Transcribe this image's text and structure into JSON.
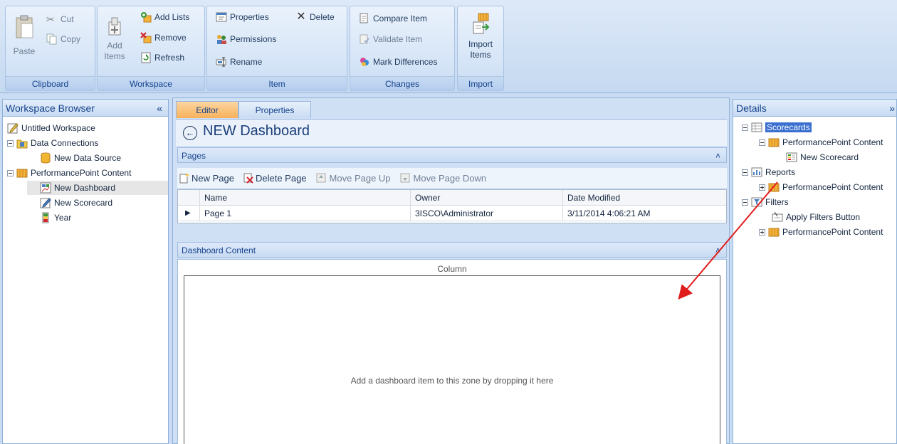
{
  "ribbon": {
    "clipboard": {
      "label": "Clipboard",
      "paste": "Paste",
      "cut": "Cut",
      "copy": "Copy"
    },
    "workspace": {
      "label": "Workspace",
      "add_items": [
        "Add",
        "Items"
      ],
      "add_lists": "Add Lists",
      "remove": "Remove",
      "refresh": "Refresh"
    },
    "item": {
      "label": "Item",
      "properties": "Properties",
      "delete": "Delete",
      "permissions": "Permissions",
      "rename": "Rename"
    },
    "changes": {
      "label": "Changes",
      "compare": "Compare Item",
      "validate": "Validate Item",
      "mark": "Mark Differences"
    },
    "import": {
      "label": "Import",
      "import_items": [
        "Import",
        "Items"
      ]
    }
  },
  "workspace_browser": {
    "title": "Workspace Browser",
    "collapse": "«",
    "items": [
      {
        "label": "Untitled Workspace",
        "icon": "workspace-icon"
      },
      {
        "label": "Data Connections",
        "icon": "data-connections-folder-icon"
      },
      {
        "label": "New Data Source",
        "icon": "data-source-icon"
      },
      {
        "label": "PerformancePoint Content",
        "icon": "performancepoint-folder-icon"
      },
      {
        "label": "New Dashboard",
        "icon": "dashboard-icon"
      },
      {
        "label": "New Scorecard",
        "icon": "scorecard-icon"
      },
      {
        "label": "Year",
        "icon": "kpi-icon"
      }
    ]
  },
  "editor": {
    "tabs": [
      "Editor",
      "Properties"
    ],
    "title": "NEW Dashboard",
    "pages_header": "Pages",
    "toolbar": {
      "new_page": "New Page",
      "delete_page": "Delete Page",
      "move_up": "Move Page Up",
      "move_down": "Move Page Down"
    },
    "columns": [
      "Name",
      "Owner",
      "Date Modified"
    ],
    "rows": [
      {
        "name": "Page 1",
        "owner": "3ISCO\\Administrator",
        "date": "3/11/2014 4:06:21 AM"
      }
    ],
    "content_header": "Dashboard Content",
    "column_label": "Column",
    "drop_hint": "Add a dashboard item to this zone by dropping it here"
  },
  "details": {
    "title": "Details",
    "expand": "»",
    "items": [
      {
        "label": "Scorecards"
      },
      {
        "label": "PerformancePoint Content"
      },
      {
        "label": "New Scorecard"
      },
      {
        "label": "Reports"
      },
      {
        "label": "PerformancePoint Content"
      },
      {
        "label": "Filters"
      },
      {
        "label": "Apply Filters Button"
      },
      {
        "label": "PerformancePoint Content"
      }
    ]
  },
  "colors": {
    "accent": "#15428b",
    "selection": "#3a6fd0",
    "active_tab": "#f7b15a",
    "arrow": "#e01b1b"
  }
}
